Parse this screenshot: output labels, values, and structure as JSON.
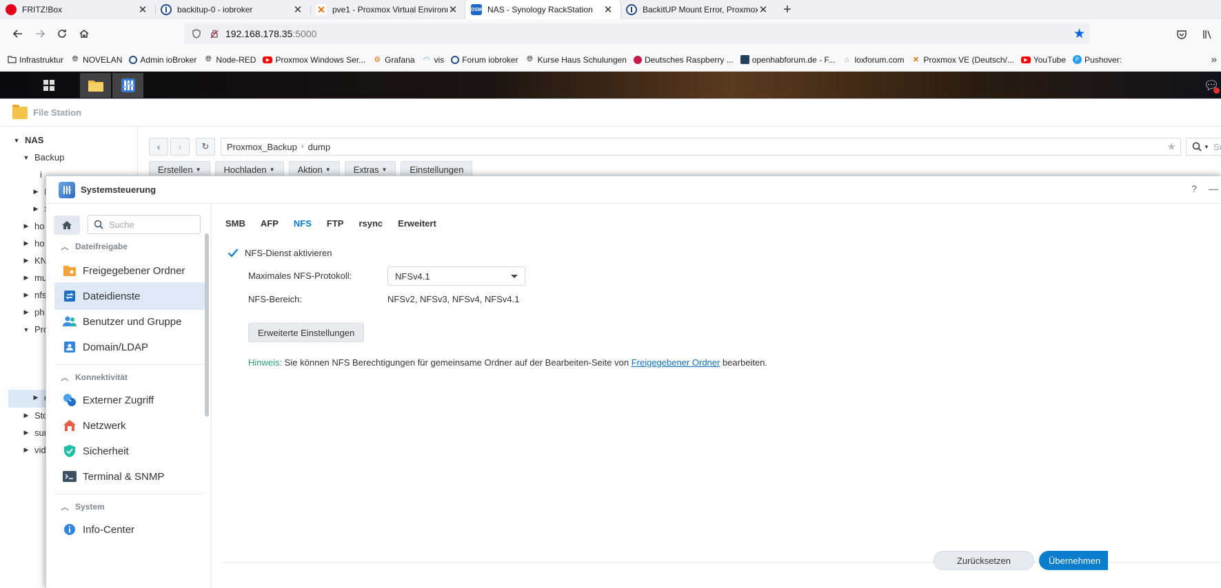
{
  "browser": {
    "tabs": [
      {
        "title": "FRITZ!Box",
        "icon": "fritzbox-icon"
      },
      {
        "title": "backitup-0 - iobroker",
        "icon": "iobroker-icon"
      },
      {
        "title": "pve1 - Proxmox Virtual Environm",
        "icon": "proxmox-icon"
      },
      {
        "title": "NAS - Synology RackStation",
        "icon": "dsm-icon",
        "favicon_text": "DSM",
        "active": true
      },
      {
        "title": "BackitUP Mount Error, Proxmox",
        "icon": "iobroker-icon"
      }
    ],
    "url_host": "192.168.178.35",
    "url_port": ":5000",
    "bookmarks": [
      {
        "label": "Infrastruktur",
        "icon": "folder-icon"
      },
      {
        "label": "NOVELAN",
        "icon": "globe-icon"
      },
      {
        "label": "Admin ioBroker",
        "icon": "iobroker-icon"
      },
      {
        "label": "Node-RED",
        "icon": "globe-icon"
      },
      {
        "label": "Proxmox Windows Ser...",
        "icon": "youtube-icon"
      },
      {
        "label": "Grafana",
        "icon": "grafana-icon"
      },
      {
        "label": "vis",
        "icon": "gauge-icon"
      },
      {
        "label": "Forum iobroker",
        "icon": "iobroker-icon"
      },
      {
        "label": "Kurse Haus Schulungen",
        "icon": "globe-icon"
      },
      {
        "label": "Deutsches Raspberry ...",
        "icon": "raspberry-icon"
      },
      {
        "label": "openhabforum.de - F...",
        "icon": "openhab-icon"
      },
      {
        "label": "loxforum.com",
        "icon": "loxone-icon"
      },
      {
        "label": "Proxmox VE (Deutsch/...",
        "icon": "proxmox-icon"
      },
      {
        "label": "YouTube",
        "icon": "youtube-icon"
      },
      {
        "label": "Pushover:",
        "icon": "pushover-icon"
      }
    ]
  },
  "file_station": {
    "title": "File Station",
    "tree": {
      "root": "NAS",
      "backup": "Backup",
      "partial": [
        "ho",
        "ho",
        "KN",
        "mu",
        "nfs",
        "ph",
        "Pro",
        "Sto",
        "sur",
        "vid"
      ],
      "child_partial": [
        "i",
        "I",
        "S",
        "d"
      ]
    },
    "path": [
      "Proxmox_Backup",
      "dump"
    ],
    "search_partial": "Su",
    "actions": [
      {
        "label": "Erstellen",
        "dropdown": true
      },
      {
        "label": "Hochladen",
        "dropdown": true
      },
      {
        "label": "Aktion",
        "dropdown": true
      },
      {
        "label": "Extras",
        "dropdown": true
      },
      {
        "label": "Einstellungen",
        "dropdown": false
      }
    ]
  },
  "control_panel": {
    "title": "Systemsteuerung",
    "help": "?",
    "search_placeholder": "Suche",
    "categories": {
      "file_sharing": "Dateifreigabe",
      "connectivity": "Konnektivität",
      "system": "System"
    },
    "nav": {
      "shared_folder": "Freigegebener Ordner",
      "file_services": "Dateidienste",
      "users_groups": "Benutzer und Gruppe",
      "domain_ldap": "Domain/LDAP",
      "external_access": "Externer Zugriff",
      "network": "Netzwerk",
      "security": "Sicherheit",
      "terminal_snmp": "Terminal & SNMP",
      "info_center": "Info-Center"
    },
    "tabs": [
      "SMB",
      "AFP",
      "NFS",
      "FTP",
      "rsync",
      "Erweitert"
    ],
    "active_tab": "NFS",
    "nfs": {
      "enable_label": "NFS-Dienst aktivieren",
      "enabled": true,
      "max_protocol_label": "Maximales NFS-Protokoll:",
      "max_protocol_value": "NFSv4.1",
      "range_label": "NFS-Bereich:",
      "range_value": "NFSv2, NFSv3, NFSv4, NFSv4.1",
      "advanced_button": "Erweiterte Einstellungen",
      "hint_label": "Hinweis:",
      "hint_text": " Sie können NFS Berechtigungen für gemeinsame Ordner auf der Bearbeiten-Seite von ",
      "hint_link": "Freigegebener Ordner",
      "hint_suffix": " bearbeiten."
    },
    "buttons": {
      "reset": "Zurücksetzen",
      "apply": "Übernehmen"
    }
  },
  "colors": {
    "accent": "#0a7ecc",
    "hint": "#2a9d7c",
    "active_nav": "#dde9f6"
  }
}
